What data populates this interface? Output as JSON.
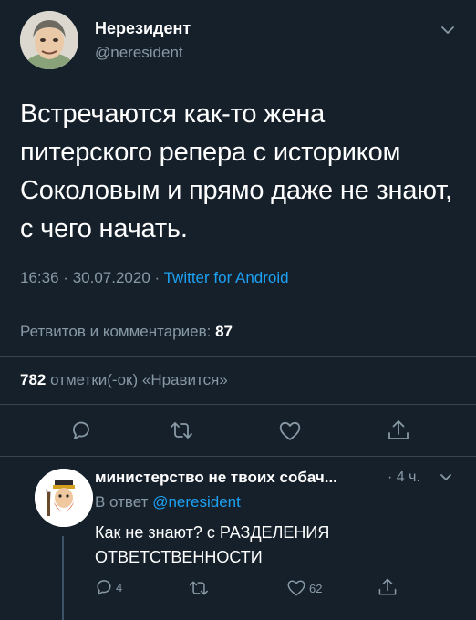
{
  "tweet": {
    "display_name": "Нерезидент",
    "handle": "@neresident",
    "text": "Встречаются как-то жена питерского репера с историком Соколовым и прямо даже не знают, с чего начать.",
    "time": "16:36",
    "sep1": "·",
    "date": "30.07.2020",
    "sep2": "·",
    "source": "Twitter for Android",
    "retweets_label": "Ретвитов и комментариев:",
    "retweets_count": "87",
    "likes_count": "782",
    "likes_label": "отметки(-ок) «Нравится»"
  },
  "icons": {
    "menu": "chevron-down-icon",
    "reply": "reply-icon",
    "retweet": "retweet-icon",
    "like": "heart-icon",
    "share": "share-icon"
  },
  "reply": {
    "display_name": "министерство не твоих собач...",
    "time": "· 4 ч.",
    "in_reply_prefix": "В ответ",
    "in_reply_handle": "@neresident",
    "text": "Как не знают? с РАЗДЕЛЕНИЯ ОТВЕТСТВЕННОСТИ",
    "reply_count": "4",
    "like_count": "62"
  },
  "colors": {
    "background": "#15202b",
    "muted": "#8899a6",
    "link": "#1da1f2",
    "divider": "#38444d"
  }
}
